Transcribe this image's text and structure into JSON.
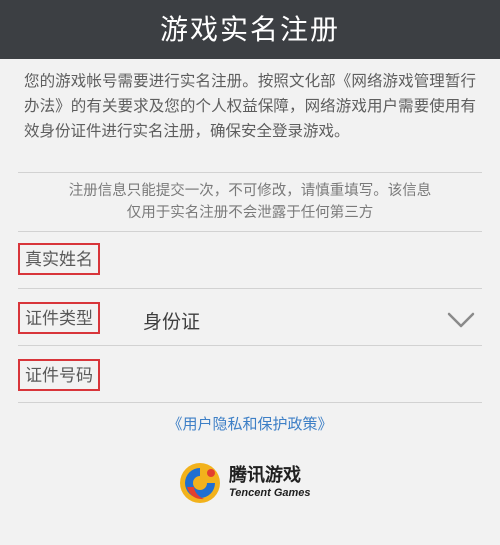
{
  "header": {
    "title": "游戏实名注册"
  },
  "intro": {
    "text": "您的游戏帐号需要进行实名注册。按照文化部《网络游戏管理暂行办法》的有关要求及您的个人权益保障，网络游戏用户需要使用有效身份证件进行实名注册，确保安全登录游戏。"
  },
  "notice": {
    "line1": "注册信息只能提交一次，不可修改，请慎重填写。该信息",
    "line2": "仅用于实名注册不会泄露于任何第三方"
  },
  "form": {
    "name_label": "真实姓名",
    "id_type_label": "证件类型",
    "id_type_value": "身份证",
    "id_number_label": "证件号码"
  },
  "policy": {
    "link_text": "《用户隐私和保护政策》"
  },
  "logo": {
    "chinese": "腾讯游戏",
    "english": "Tencent Games"
  },
  "colors": {
    "header_bg": "#3c3f43",
    "highlight_border": "#d8353a",
    "link": "#3d7fc6"
  },
  "icons": {
    "dropdown": "chevron-down-icon",
    "logo": "tencent-games-logo-icon"
  }
}
